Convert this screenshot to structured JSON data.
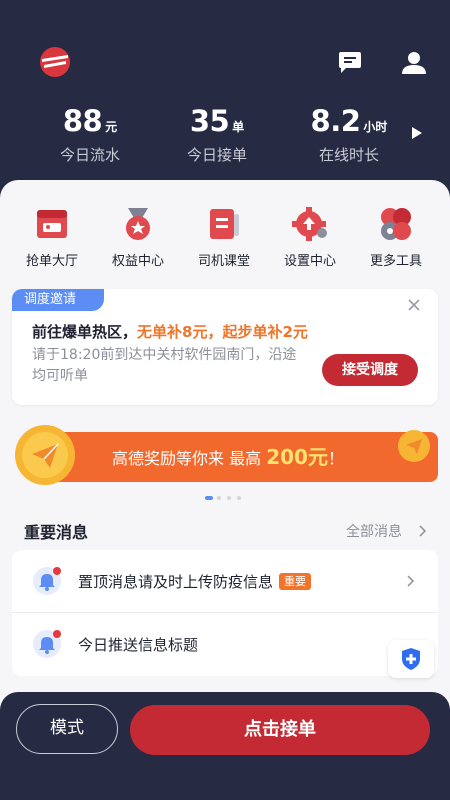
{
  "header": {
    "logo_icon": "brand-logo",
    "icons": [
      "message-icon",
      "user-icon"
    ],
    "background": "#262a42"
  },
  "stats": [
    {
      "value": "88",
      "unit": "元",
      "label": "今日流水"
    },
    {
      "value": "35",
      "unit": "单",
      "label": "今日接单"
    },
    {
      "value": "8.2",
      "unit": "小时",
      "label": "在线时长"
    }
  ],
  "menu": [
    {
      "label": "抢单大厅",
      "icon": "order-hall-icon"
    },
    {
      "label": "权益中心",
      "icon": "medal-icon"
    },
    {
      "label": "司机课堂",
      "icon": "classroom-icon"
    },
    {
      "label": "设置中心",
      "icon": "settings-gear-icon"
    },
    {
      "label": "更多工具",
      "icon": "more-tools-icon"
    }
  ],
  "dispatch": {
    "tag": "调度邀请",
    "title_prefix": "前往爆单热区，",
    "title_highlight": "无单补8元，起步单补2元",
    "desc": "请于18:20前到达中关村软件园南门，沿途均可听单",
    "button": "接受调度"
  },
  "banner": {
    "text_prefix": "高德奖励等你来 最高",
    "amount": "200元",
    "suffix": "！",
    "dots": 4,
    "active_dot": 0
  },
  "messages_section": {
    "title": "重要消息",
    "view_all": "全部消息",
    "items": [
      {
        "text": "置顶消息请及时上传防疫信息",
        "badge": "重要"
      },
      {
        "text": "今日推送信息标题",
        "badge": ""
      }
    ]
  },
  "bottom": {
    "mode_label": "模式",
    "grab_label": "点击接单"
  },
  "colors": {
    "accent_red": "#c42a34",
    "accent_orange": "#f0742a",
    "tag_blue": "#5c8df5",
    "shield_blue": "#2f6df0"
  }
}
